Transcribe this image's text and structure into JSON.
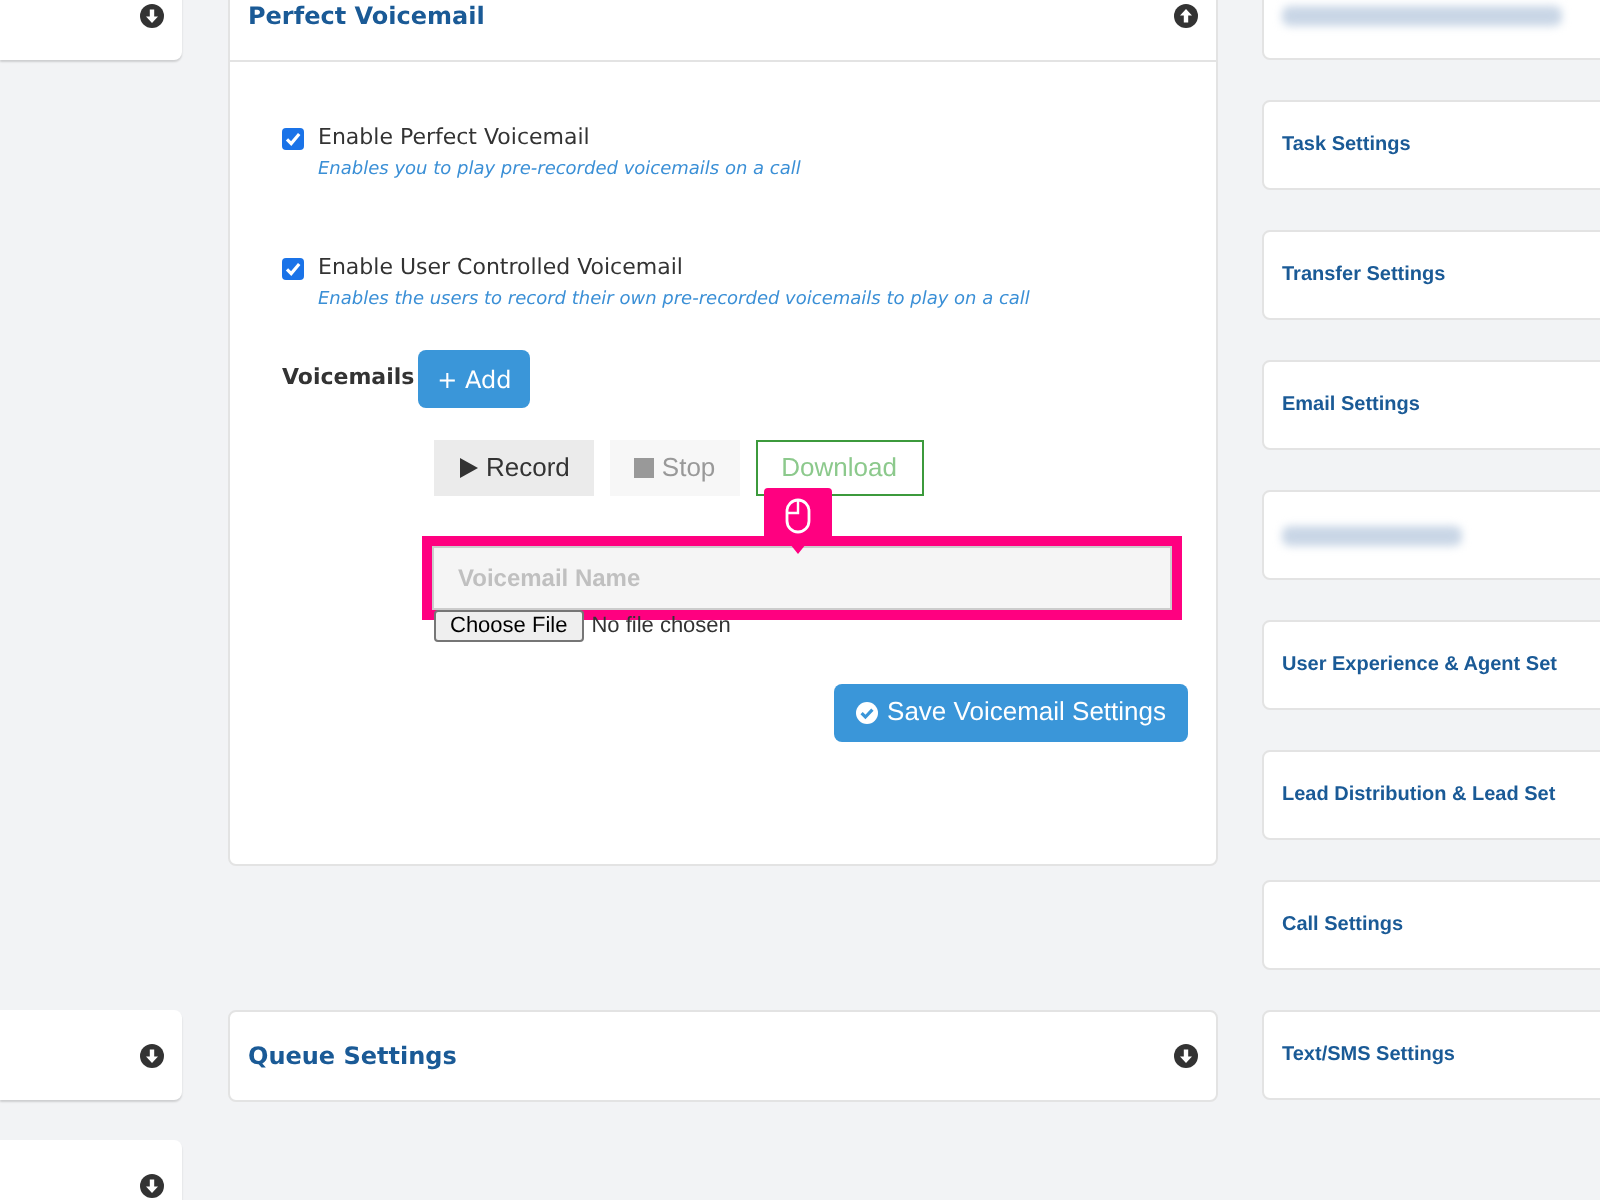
{
  "left_cards": [
    {
      "expanded": false
    },
    {
      "expanded": false
    },
    {
      "expanded": false
    }
  ],
  "voicemail_panel": {
    "title": "Perfect Voicemail",
    "expanded": true,
    "options": [
      {
        "label": "Enable Perfect Voicemail",
        "hint": "Enables you to play pre-recorded voicemails on a call",
        "checked": true
      },
      {
        "label": "Enable User Controlled Voicemail",
        "hint": "Enables the users to record their own pre-recorded voicemails to play on a call",
        "checked": true
      }
    ],
    "voicemails_label": "Voicemails",
    "add_button": "+ Add",
    "recorder": [
      {
        "kind": "record",
        "label": "Record",
        "disabled": false
      },
      {
        "kind": "stop",
        "label": "Stop",
        "disabled": true
      },
      {
        "kind": "download",
        "label": "Download",
        "disabled": false
      }
    ],
    "name_field": {
      "placeholder": "Voicemail Name",
      "highlighted": true
    },
    "file_picker": {
      "button": "Choose File",
      "status": "No file chosen"
    },
    "save_button": "Save Voicemail Settings"
  },
  "queue_panel": {
    "title": "Queue Settings",
    "expanded": false
  },
  "right_cards": [
    {
      "kind": "blurred"
    },
    {
      "kind": "title",
      "title": "Task Settings"
    },
    {
      "kind": "title",
      "title": "Transfer Settings"
    },
    {
      "kind": "title",
      "title": "Email Settings"
    },
    {
      "kind": "blurred"
    },
    {
      "kind": "title",
      "title": "User Experience & Agent Set"
    },
    {
      "kind": "title",
      "title": "Lead Distribution & Lead Set"
    },
    {
      "kind": "title",
      "title": "Call Settings"
    },
    {
      "kind": "title",
      "title": "Text/SMS Settings"
    }
  ]
}
